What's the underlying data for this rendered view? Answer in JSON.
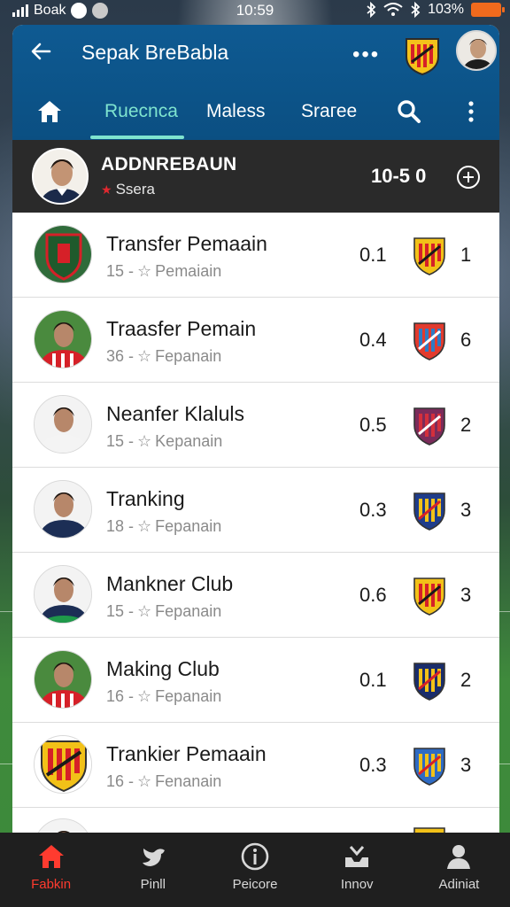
{
  "status_bar": {
    "carrier": "Boak",
    "time": "10:59",
    "battery": "103%"
  },
  "header": {
    "title": "Sepak BreBabla",
    "more_icon": "ellipsis-icon",
    "tabs": [
      {
        "label": "Ruecnca",
        "active": true
      },
      {
        "label": "Maless",
        "active": false
      },
      {
        "label": "Srагее",
        "active": false
      }
    ]
  },
  "featured": {
    "name": "ADDNREBAUN",
    "subtitle": "Ssera",
    "score": "10-5 0"
  },
  "rows": [
    {
      "name": "Transfer Pemaain",
      "meta_num": "15",
      "meta_text": "Pemaiain",
      "value": "0.1",
      "rank": "1",
      "avatar": "crest-green"
    },
    {
      "name": "Traasfer Pemain",
      "meta_num": "36",
      "meta_text": "Fepanain",
      "value": "0.4",
      "rank": "6",
      "avatar": "player-red"
    },
    {
      "name": "Neanfer Klaluls",
      "meta_num": "15",
      "meta_text": "Kepanain",
      "value": "0.5",
      "rank": "2",
      "avatar": "player-white"
    },
    {
      "name": "Tranking",
      "meta_num": "18",
      "meta_text": "Fepanain",
      "value": "0.3",
      "rank": "3",
      "avatar": "player-navy"
    },
    {
      "name": "Mankner Club",
      "meta_num": "15",
      "meta_text": "Fepanain",
      "value": "0.6",
      "rank": "3",
      "avatar": "player-navy-green"
    },
    {
      "name": "Making Club",
      "meta_num": "16",
      "meta_text": "Fepanain",
      "value": "0.1",
      "rank": "2",
      "avatar": "player-red"
    },
    {
      "name": "Trankier Pemaain",
      "meta_num": "16",
      "meta_text": "Fenanain",
      "value": "0.3",
      "rank": "3",
      "avatar": "crest-red"
    }
  ],
  "bottom_nav": [
    {
      "label": "Fabkin",
      "icon": "home-icon",
      "active": true
    },
    {
      "label": "Pinll",
      "icon": "bird-icon",
      "active": false
    },
    {
      "label": "Peicore",
      "icon": "info-icon",
      "active": false
    },
    {
      "label": "Innov",
      "icon": "inbox-icon",
      "active": false
    },
    {
      "label": "Adiniat",
      "icon": "person-icon",
      "active": false
    }
  ],
  "colors": {
    "header_blue": "#0b4f82",
    "tab_active": "#7fe4cf",
    "nav_active": "#ff3b2f",
    "featured_bg": "#2a2a2a"
  }
}
